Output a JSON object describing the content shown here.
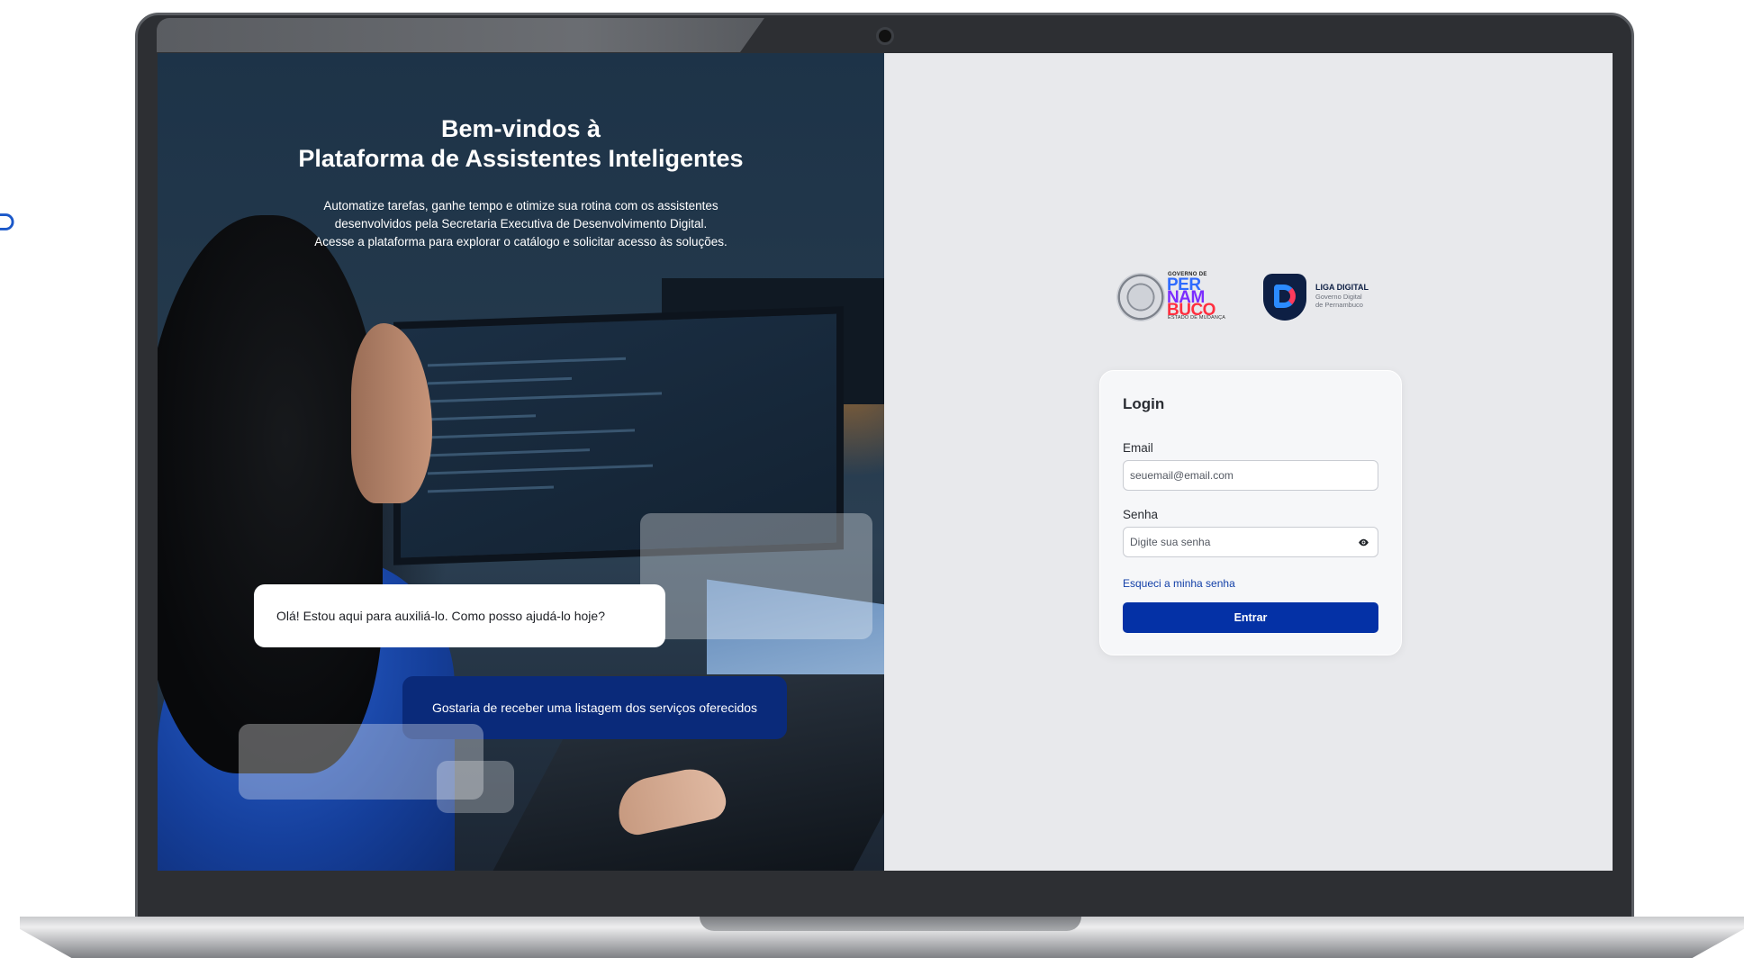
{
  "hero": {
    "title_line1": "Bem-vindos à",
    "title_line2": "Plataforma de Assistentes Inteligentes",
    "subtitle_line1": "Automatize tarefas, ganhe tempo e otimize sua rotina com os assistentes",
    "subtitle_line2": "desenvolvidos pela Secretaria Executiva de Desenvolvimento Digital.",
    "subtitle_line3": "Acesse a plataforma para explorar o catálogo e solicitar acesso às soluções.",
    "bubble_assistant": "Olá! Estou aqui para auxiliá-lo. Como posso ajudá-lo hoje?",
    "bubble_user": "Gostaria de receber uma listagem dos serviços oferecidos"
  },
  "logos": {
    "gov_small": "GOVERNO DE",
    "gov_line1": "PER",
    "gov_line2": "NAM",
    "gov_line3": "BUCO",
    "gov_tag": "ESTADO DE MUDANÇA",
    "liga_title": "LIGA DIGITAL",
    "liga_sub_line1": "Governo Digital",
    "liga_sub_line2": "de Pernambuco"
  },
  "login": {
    "title": "Login",
    "email_label": "Email",
    "email_placeholder": "seuemail@email.com",
    "password_label": "Senha",
    "password_placeholder": "Digite sua senha",
    "forgot_link": "Esqueci a minha senha",
    "submit_label": "Entrar"
  },
  "colors": {
    "primary": "#0431a6",
    "link": "#1340a8",
    "bubble_user_bg": "#0a2a7a",
    "screen_bg": "#e8e9ec"
  },
  "icons": {
    "password_toggle": "eye-icon",
    "camera": "webcam"
  }
}
